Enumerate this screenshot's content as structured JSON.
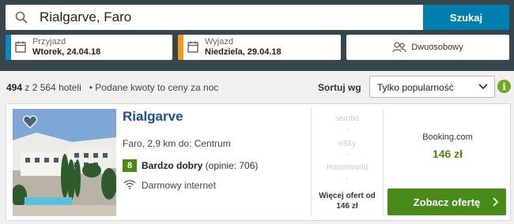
{
  "search": {
    "value": "Rialgarve, Faro",
    "button": "Szukaj"
  },
  "checkin": {
    "label": "Przyjazd",
    "value": "Wtorek, 24.04.18",
    "accent": "#0a86c0"
  },
  "checkout": {
    "label": "Wyjazd",
    "value": "Niedziela, 29.04.18",
    "accent": "#f39c1c"
  },
  "room": {
    "label": "Dwuosobowy"
  },
  "results": {
    "count": "494",
    "total": " z 2 564 hoteli",
    "note": "•  Podane kwoty to ceny za noc"
  },
  "sort": {
    "label": "Sortuj wg",
    "selected": "Tylko popularność",
    "info": "i"
  },
  "hotel": {
    "name": "Rialgarve",
    "location": "Faro, 2,9 km do: Centrum",
    "score": "8",
    "rating_label": "Bardzo dobry",
    "rating_count": " (opinie: 706)",
    "amenity": "Darmowy internet",
    "partners": [
      "sembo",
      "eSky",
      "Hostelworld"
    ],
    "dashes": [
      "-",
      "-",
      "-"
    ],
    "more_offers": "Więcej ofert od 146 zł",
    "provider": "Booking.com",
    "price": "146 zł",
    "cta": "Zobacz ofertę"
  },
  "colors": {
    "topbar": "#37454d",
    "search_button": "#007faf",
    "price": "#4c8a14",
    "cta": "#488b19",
    "hotel_name": "#1a4f8b"
  },
  "icons": [
    "search-icon",
    "calendar-icon",
    "guests-icon",
    "chevron-down-icon",
    "info-icon",
    "heart-icon",
    "wifi-icon",
    "arrow-right-icon"
  ]
}
